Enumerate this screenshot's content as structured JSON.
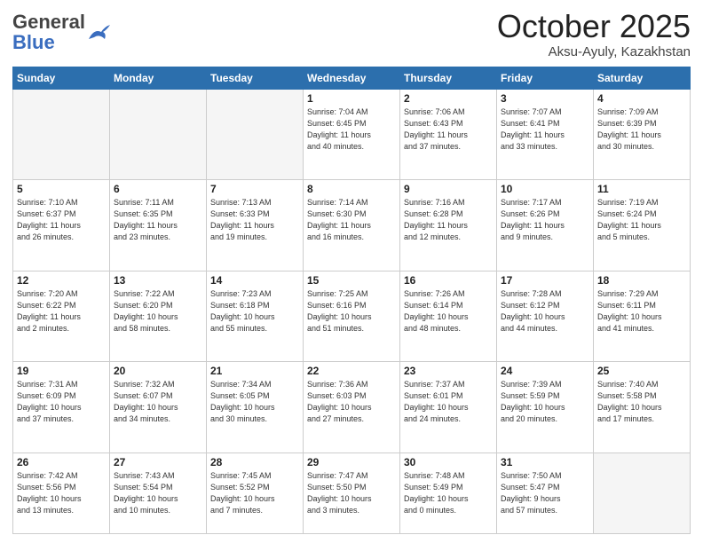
{
  "header": {
    "logo_general": "General",
    "logo_blue": "Blue",
    "month_title": "October 2025",
    "subtitle": "Aksu-Ayuly, Kazakhstan"
  },
  "weekdays": [
    "Sunday",
    "Monday",
    "Tuesday",
    "Wednesday",
    "Thursday",
    "Friday",
    "Saturday"
  ],
  "weeks": [
    [
      {
        "num": "",
        "info": ""
      },
      {
        "num": "",
        "info": ""
      },
      {
        "num": "",
        "info": ""
      },
      {
        "num": "1",
        "info": "Sunrise: 7:04 AM\nSunset: 6:45 PM\nDaylight: 11 hours\nand 40 minutes."
      },
      {
        "num": "2",
        "info": "Sunrise: 7:06 AM\nSunset: 6:43 PM\nDaylight: 11 hours\nand 37 minutes."
      },
      {
        "num": "3",
        "info": "Sunrise: 7:07 AM\nSunset: 6:41 PM\nDaylight: 11 hours\nand 33 minutes."
      },
      {
        "num": "4",
        "info": "Sunrise: 7:09 AM\nSunset: 6:39 PM\nDaylight: 11 hours\nand 30 minutes."
      }
    ],
    [
      {
        "num": "5",
        "info": "Sunrise: 7:10 AM\nSunset: 6:37 PM\nDaylight: 11 hours\nand 26 minutes."
      },
      {
        "num": "6",
        "info": "Sunrise: 7:11 AM\nSunset: 6:35 PM\nDaylight: 11 hours\nand 23 minutes."
      },
      {
        "num": "7",
        "info": "Sunrise: 7:13 AM\nSunset: 6:33 PM\nDaylight: 11 hours\nand 19 minutes."
      },
      {
        "num": "8",
        "info": "Sunrise: 7:14 AM\nSunset: 6:30 PM\nDaylight: 11 hours\nand 16 minutes."
      },
      {
        "num": "9",
        "info": "Sunrise: 7:16 AM\nSunset: 6:28 PM\nDaylight: 11 hours\nand 12 minutes."
      },
      {
        "num": "10",
        "info": "Sunrise: 7:17 AM\nSunset: 6:26 PM\nDaylight: 11 hours\nand 9 minutes."
      },
      {
        "num": "11",
        "info": "Sunrise: 7:19 AM\nSunset: 6:24 PM\nDaylight: 11 hours\nand 5 minutes."
      }
    ],
    [
      {
        "num": "12",
        "info": "Sunrise: 7:20 AM\nSunset: 6:22 PM\nDaylight: 11 hours\nand 2 minutes."
      },
      {
        "num": "13",
        "info": "Sunrise: 7:22 AM\nSunset: 6:20 PM\nDaylight: 10 hours\nand 58 minutes."
      },
      {
        "num": "14",
        "info": "Sunrise: 7:23 AM\nSunset: 6:18 PM\nDaylight: 10 hours\nand 55 minutes."
      },
      {
        "num": "15",
        "info": "Sunrise: 7:25 AM\nSunset: 6:16 PM\nDaylight: 10 hours\nand 51 minutes."
      },
      {
        "num": "16",
        "info": "Sunrise: 7:26 AM\nSunset: 6:14 PM\nDaylight: 10 hours\nand 48 minutes."
      },
      {
        "num": "17",
        "info": "Sunrise: 7:28 AM\nSunset: 6:12 PM\nDaylight: 10 hours\nand 44 minutes."
      },
      {
        "num": "18",
        "info": "Sunrise: 7:29 AM\nSunset: 6:11 PM\nDaylight: 10 hours\nand 41 minutes."
      }
    ],
    [
      {
        "num": "19",
        "info": "Sunrise: 7:31 AM\nSunset: 6:09 PM\nDaylight: 10 hours\nand 37 minutes."
      },
      {
        "num": "20",
        "info": "Sunrise: 7:32 AM\nSunset: 6:07 PM\nDaylight: 10 hours\nand 34 minutes."
      },
      {
        "num": "21",
        "info": "Sunrise: 7:34 AM\nSunset: 6:05 PM\nDaylight: 10 hours\nand 30 minutes."
      },
      {
        "num": "22",
        "info": "Sunrise: 7:36 AM\nSunset: 6:03 PM\nDaylight: 10 hours\nand 27 minutes."
      },
      {
        "num": "23",
        "info": "Sunrise: 7:37 AM\nSunset: 6:01 PM\nDaylight: 10 hours\nand 24 minutes."
      },
      {
        "num": "24",
        "info": "Sunrise: 7:39 AM\nSunset: 5:59 PM\nDaylight: 10 hours\nand 20 minutes."
      },
      {
        "num": "25",
        "info": "Sunrise: 7:40 AM\nSunset: 5:58 PM\nDaylight: 10 hours\nand 17 minutes."
      }
    ],
    [
      {
        "num": "26",
        "info": "Sunrise: 7:42 AM\nSunset: 5:56 PM\nDaylight: 10 hours\nand 13 minutes."
      },
      {
        "num": "27",
        "info": "Sunrise: 7:43 AM\nSunset: 5:54 PM\nDaylight: 10 hours\nand 10 minutes."
      },
      {
        "num": "28",
        "info": "Sunrise: 7:45 AM\nSunset: 5:52 PM\nDaylight: 10 hours\nand 7 minutes."
      },
      {
        "num": "29",
        "info": "Sunrise: 7:47 AM\nSunset: 5:50 PM\nDaylight: 10 hours\nand 3 minutes."
      },
      {
        "num": "30",
        "info": "Sunrise: 7:48 AM\nSunset: 5:49 PM\nDaylight: 10 hours\nand 0 minutes."
      },
      {
        "num": "31",
        "info": "Sunrise: 7:50 AM\nSunset: 5:47 PM\nDaylight: 9 hours\nand 57 minutes."
      },
      {
        "num": "",
        "info": ""
      }
    ]
  ]
}
